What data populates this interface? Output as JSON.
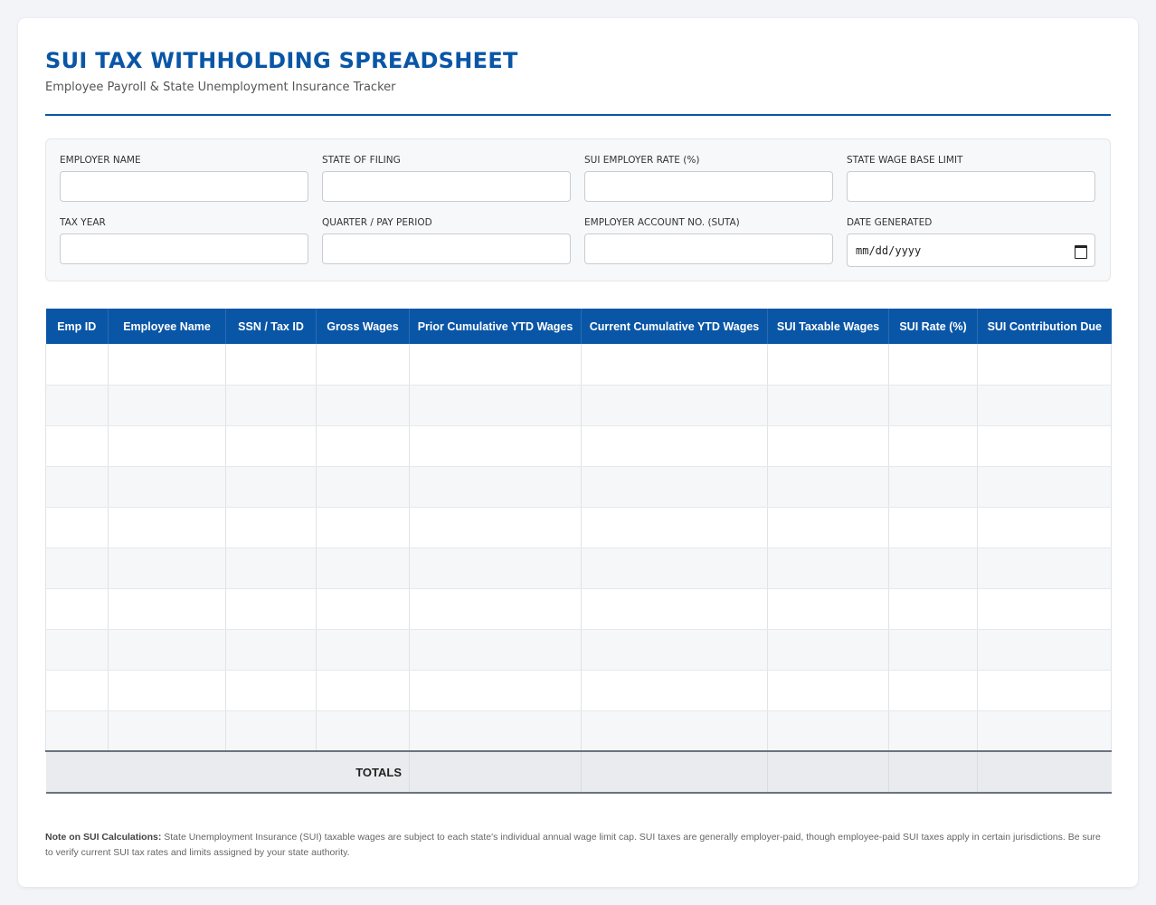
{
  "header": {
    "title": "SUI TAX WITHHOLDING SPREADSHEET",
    "subtitle": "Employee Payroll & State Unemployment Insurance Tracker"
  },
  "form": {
    "employer_name": {
      "label": "EMPLOYER NAME",
      "value": ""
    },
    "state_of_filing": {
      "label": "STATE OF FILING",
      "value": ""
    },
    "sui_employer_rate": {
      "label": "SUI EMPLOYER RATE (%)",
      "value": ""
    },
    "state_wage_base_limit": {
      "label": "STATE WAGE BASE LIMIT",
      "value": ""
    },
    "tax_year": {
      "label": "TAX YEAR",
      "value": ""
    },
    "quarter_pay_period": {
      "label": "QUARTER / PAY PERIOD",
      "value": ""
    },
    "employer_account_no": {
      "label": "EMPLOYER ACCOUNT NO. (SUTA)",
      "value": ""
    },
    "date_generated": {
      "label": "DATE GENERATED",
      "placeholder": "mm/dd/yyyy"
    }
  },
  "table": {
    "columns": [
      "Emp ID",
      "Employee Name",
      "SSN / Tax ID",
      "Gross Wages",
      "Prior Cumulative YTD Wages",
      "Current Cumulative YTD Wages",
      "SUI Taxable Wages",
      "SUI Rate (%)",
      "SUI Contribution Due"
    ],
    "row_count": 10,
    "totals_label": "TOTALS"
  },
  "note": {
    "heading": "Note on SUI Calculations:",
    "text": "State Unemployment Insurance (SUI) taxable wages are subject to each state's individual annual wage limit cap. SUI taxes are generally employer-paid, though employee-paid SUI taxes apply in certain jurisdictions. Be sure to verify current SUI tax rates and limits assigned by your state authority."
  },
  "colors": {
    "accent": "#0a56a6",
    "background": "#f3f4f8"
  }
}
